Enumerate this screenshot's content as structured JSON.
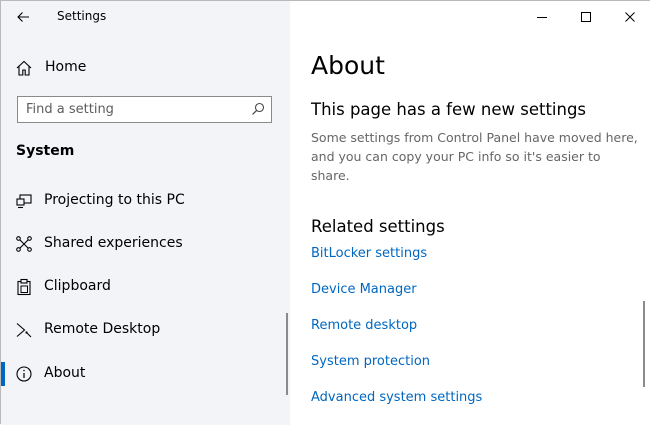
{
  "window": {
    "title": "Settings"
  },
  "sidebar": {
    "home_label": "Home",
    "search_placeholder": "Find a setting",
    "section_heading": "System",
    "items": [
      {
        "label": "Projecting to this PC",
        "icon": "projector-icon"
      },
      {
        "label": "Shared experiences",
        "icon": "shared-experiences-icon"
      },
      {
        "label": "Clipboard",
        "icon": "clipboard-icon"
      },
      {
        "label": "Remote Desktop",
        "icon": "remote-desktop-icon"
      },
      {
        "label": "About",
        "icon": "info-icon",
        "selected": true
      }
    ]
  },
  "main": {
    "page_title": "About",
    "new_settings_heading": "This page has a few new settings",
    "new_settings_desc": "Some settings from Control Panel have moved here, and you can copy your PC info so it's easier to share.",
    "related_heading": "Related settings",
    "links": [
      "BitLocker settings",
      "Device Manager",
      "Remote desktop",
      "System protection",
      "Advanced system settings"
    ]
  },
  "colors": {
    "accent": "#0067c0",
    "sidebar_bg": "#f2f4f8",
    "muted_text": "#666666"
  }
}
